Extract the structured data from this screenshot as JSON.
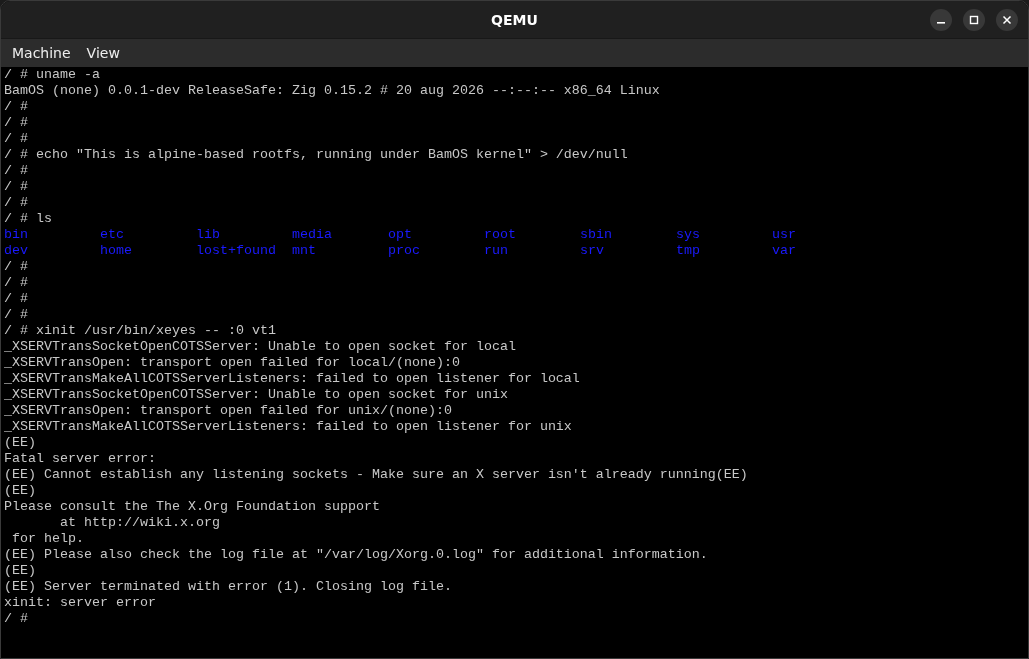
{
  "window": {
    "title": "QEMU"
  },
  "menu": [
    {
      "label": "Machine"
    },
    {
      "label": "View"
    }
  ],
  "terminal": {
    "lines": [
      {
        "kind": "text",
        "text": "/ # uname -a"
      },
      {
        "kind": "text",
        "text": "BamOS (none) 0.0.1-dev ReleaseSafe: Zig 0.15.2 # 20 aug 2026 --:--:-- x86_64 Linux"
      },
      {
        "kind": "text",
        "text": "/ #"
      },
      {
        "kind": "text",
        "text": "/ #"
      },
      {
        "kind": "text",
        "text": "/ #"
      },
      {
        "kind": "text",
        "text": "/ # echo \"This is alpine-based rootfs, running under BamOS kernel\" > /dev/null"
      },
      {
        "kind": "text",
        "text": "/ #"
      },
      {
        "kind": "text",
        "text": "/ #"
      },
      {
        "kind": "text",
        "text": "/ #"
      },
      {
        "kind": "text",
        "text": "/ # ls"
      },
      {
        "kind": "listing",
        "items": [
          "bin",
          "etc",
          "lib",
          "media",
          "opt",
          "root",
          "sbin",
          "sys",
          "usr"
        ]
      },
      {
        "kind": "listing",
        "items": [
          "dev",
          "home",
          "lost+found",
          "mnt",
          "proc",
          "run",
          "srv",
          "tmp",
          "var"
        ]
      },
      {
        "kind": "text",
        "text": "/ #"
      },
      {
        "kind": "text",
        "text": "/ #"
      },
      {
        "kind": "text",
        "text": "/ #"
      },
      {
        "kind": "text",
        "text": "/ #"
      },
      {
        "kind": "text",
        "text": "/ # xinit /usr/bin/xeyes -- :0 vt1"
      },
      {
        "kind": "text",
        "text": "_XSERVTransSocketOpenCOTSServer: Unable to open socket for local"
      },
      {
        "kind": "text",
        "text": "_XSERVTransOpen: transport open failed for local/(none):0"
      },
      {
        "kind": "text",
        "text": "_XSERVTransMakeAllCOTSServerListeners: failed to open listener for local"
      },
      {
        "kind": "text",
        "text": "_XSERVTransSocketOpenCOTSServer: Unable to open socket for unix"
      },
      {
        "kind": "text",
        "text": "_XSERVTransOpen: transport open failed for unix/(none):0"
      },
      {
        "kind": "text",
        "text": "_XSERVTransMakeAllCOTSServerListeners: failed to open listener for unix"
      },
      {
        "kind": "text",
        "text": "(EE)"
      },
      {
        "kind": "text",
        "text": "Fatal server error:"
      },
      {
        "kind": "text",
        "text": "(EE) Cannot establish any listening sockets - Make sure an X server isn't already running(EE)"
      },
      {
        "kind": "text",
        "text": "(EE)"
      },
      {
        "kind": "text",
        "text": "Please consult the The X.Org Foundation support"
      },
      {
        "kind": "text",
        "text": "       at http://wiki.x.org"
      },
      {
        "kind": "text",
        "text": " for help."
      },
      {
        "kind": "text",
        "text": "(EE) Please also check the log file at \"/var/log/Xorg.0.log\" for additional information."
      },
      {
        "kind": "text",
        "text": "(EE)"
      },
      {
        "kind": "text",
        "text": "(EE) Server terminated with error (1). Closing log file."
      },
      {
        "kind": "text",
        "text": "xinit: server error"
      },
      {
        "kind": "text",
        "text": "/ #"
      }
    ]
  }
}
